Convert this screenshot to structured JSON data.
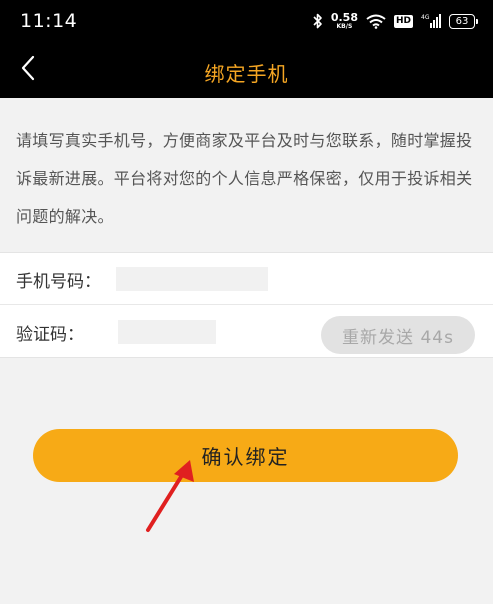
{
  "status_bar": {
    "time": "11:14",
    "net_speed_value": "0.58",
    "net_speed_unit": "KB/S",
    "hd_label": "HD",
    "network_type": "4G",
    "battery_level": "63",
    "icons": [
      "bluetooth-icon",
      "wifi-icon",
      "signal-icon",
      "battery-icon"
    ]
  },
  "nav": {
    "title": "绑定手机",
    "title_color": "#f5a623"
  },
  "notice": {
    "text": "请填写真实手机号，方便商家及平台及时与您联系，随时掌握投诉最新进展。平台将对您的个人信息严格保密，仅用于投诉相关问题的解决。"
  },
  "form": {
    "phone_label": "手机号码：",
    "phone_value": "",
    "code_label": "验证码：",
    "code_value": "",
    "resend_label": "重新发送 44s"
  },
  "actions": {
    "confirm_label": "确认绑定",
    "confirm_color": "#f7aa16"
  },
  "annotation": {
    "arrow_color": "#e02020"
  }
}
